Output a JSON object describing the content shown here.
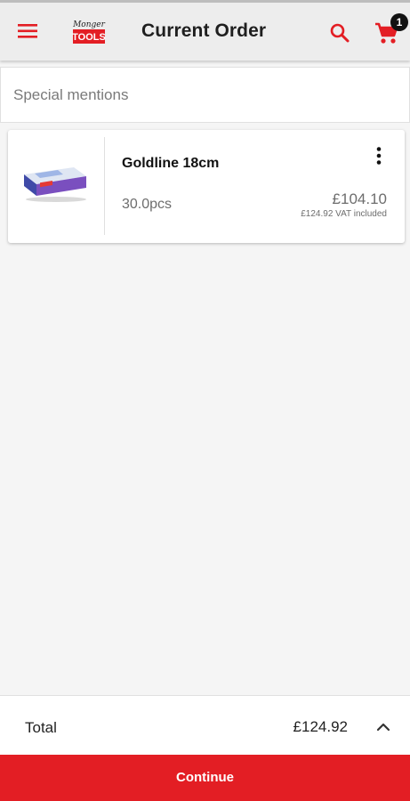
{
  "header": {
    "title": "Current Order",
    "logo_text_top": "Monger",
    "logo_text_bottom": "TOOLS",
    "cart_count": "1",
    "icons": {
      "menu": "hamburger-menu-icon",
      "search": "search-icon",
      "cart": "shopping-cart-icon"
    }
  },
  "special_mentions": {
    "placeholder": "Special mentions",
    "value": ""
  },
  "order_items": [
    {
      "name": "Goldline 18cm",
      "quantity": "30.0pcs",
      "price": "£104.10",
      "price_vat": "£124.92 VAT included"
    }
  ],
  "footer": {
    "total_label": "Total",
    "total_value": "£124.92",
    "continue_label": "Continue"
  },
  "colors": {
    "accent": "#e31e24",
    "topbar": "#ededed",
    "background": "#f5f5f5"
  }
}
